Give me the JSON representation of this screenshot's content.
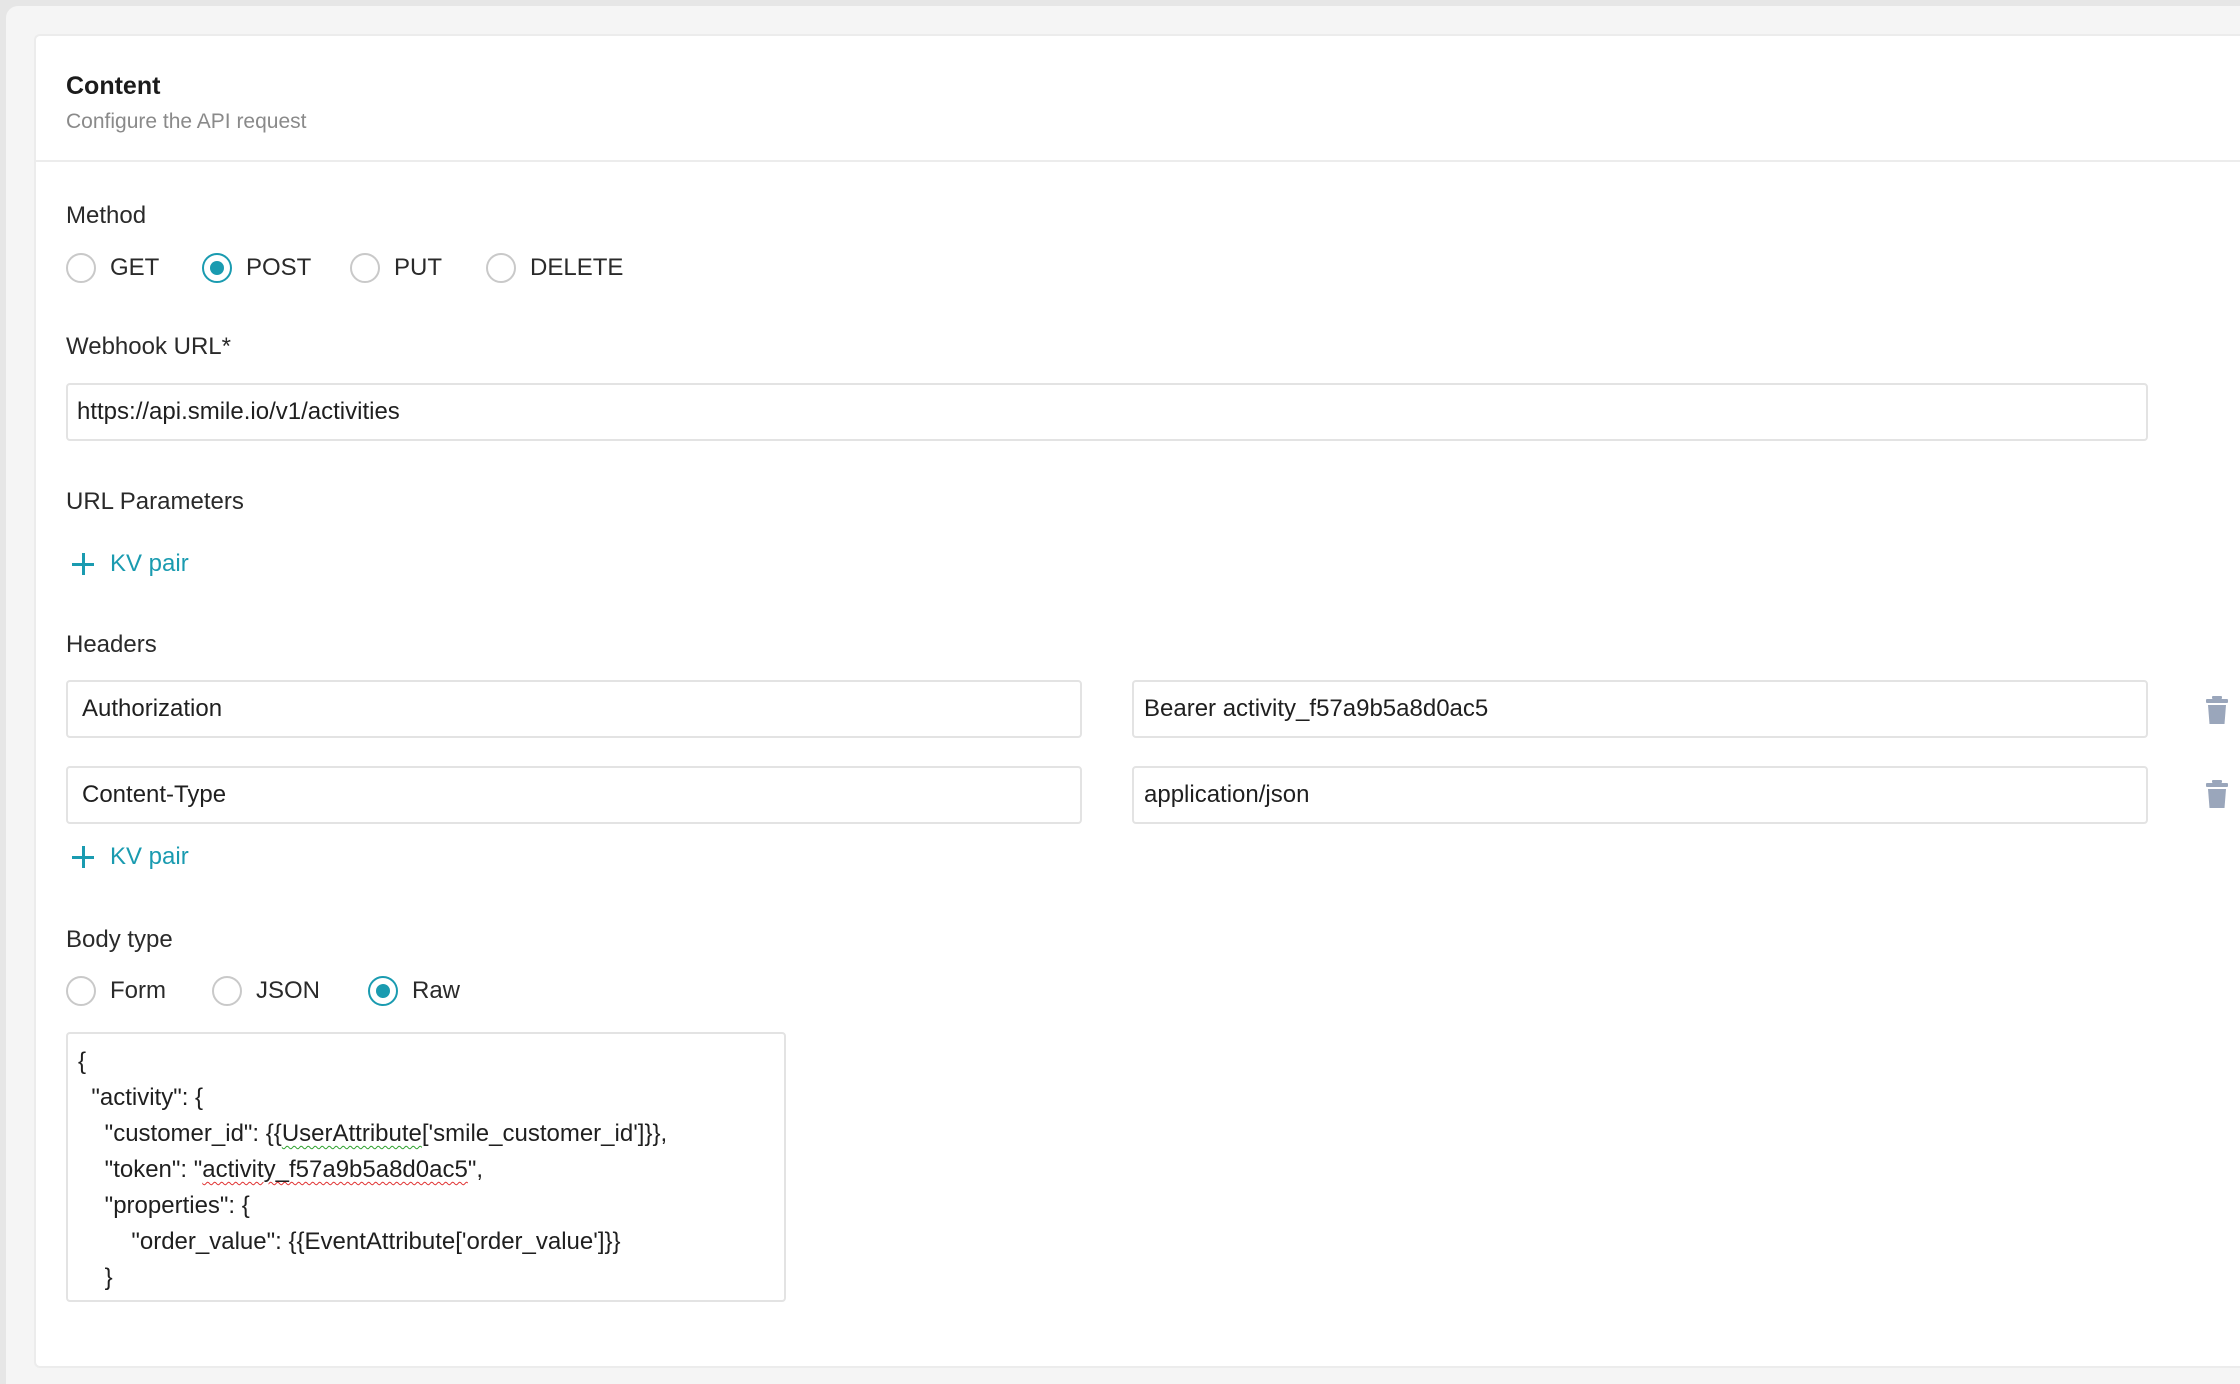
{
  "card": {
    "title": "Content",
    "subtitle": "Configure the API request"
  },
  "method": {
    "label": "Method",
    "options": [
      "GET",
      "POST",
      "PUT",
      "DELETE"
    ],
    "selected": "POST"
  },
  "webhook": {
    "label": "Webhook URL*",
    "value": "https://api.smile.io/v1/activities"
  },
  "url_parameters": {
    "label": "URL Parameters",
    "add_label": "KV pair"
  },
  "headers": {
    "label": "Headers",
    "rows": [
      {
        "key": "Authorization",
        "value": "Bearer activity_f57a9b5a8d0ac5"
      },
      {
        "key": "Content-Type",
        "value": "application/json"
      }
    ],
    "add_label": "KV pair"
  },
  "body_type": {
    "label": "Body type",
    "options": [
      "Form",
      "JSON",
      "Raw"
    ],
    "selected": "Raw"
  },
  "body": {
    "lines": [
      "{",
      "  \"activity\": {",
      "    \"customer_id\": {{",
      "UserAttribute",
      "['smile_customer_id']}},",
      "    \"token\": \"",
      "activity_f57a9b5a8d0ac5",
      "\",",
      "    \"properties\": {",
      "        \"order_value\": {{EventAttribute['order_value']}}",
      "    }"
    ]
  },
  "colors": {
    "accent": "#1a9bb0",
    "trash": "#9aa6bb"
  },
  "icons": {
    "add": "plus-icon",
    "delete": "trash-icon"
  }
}
